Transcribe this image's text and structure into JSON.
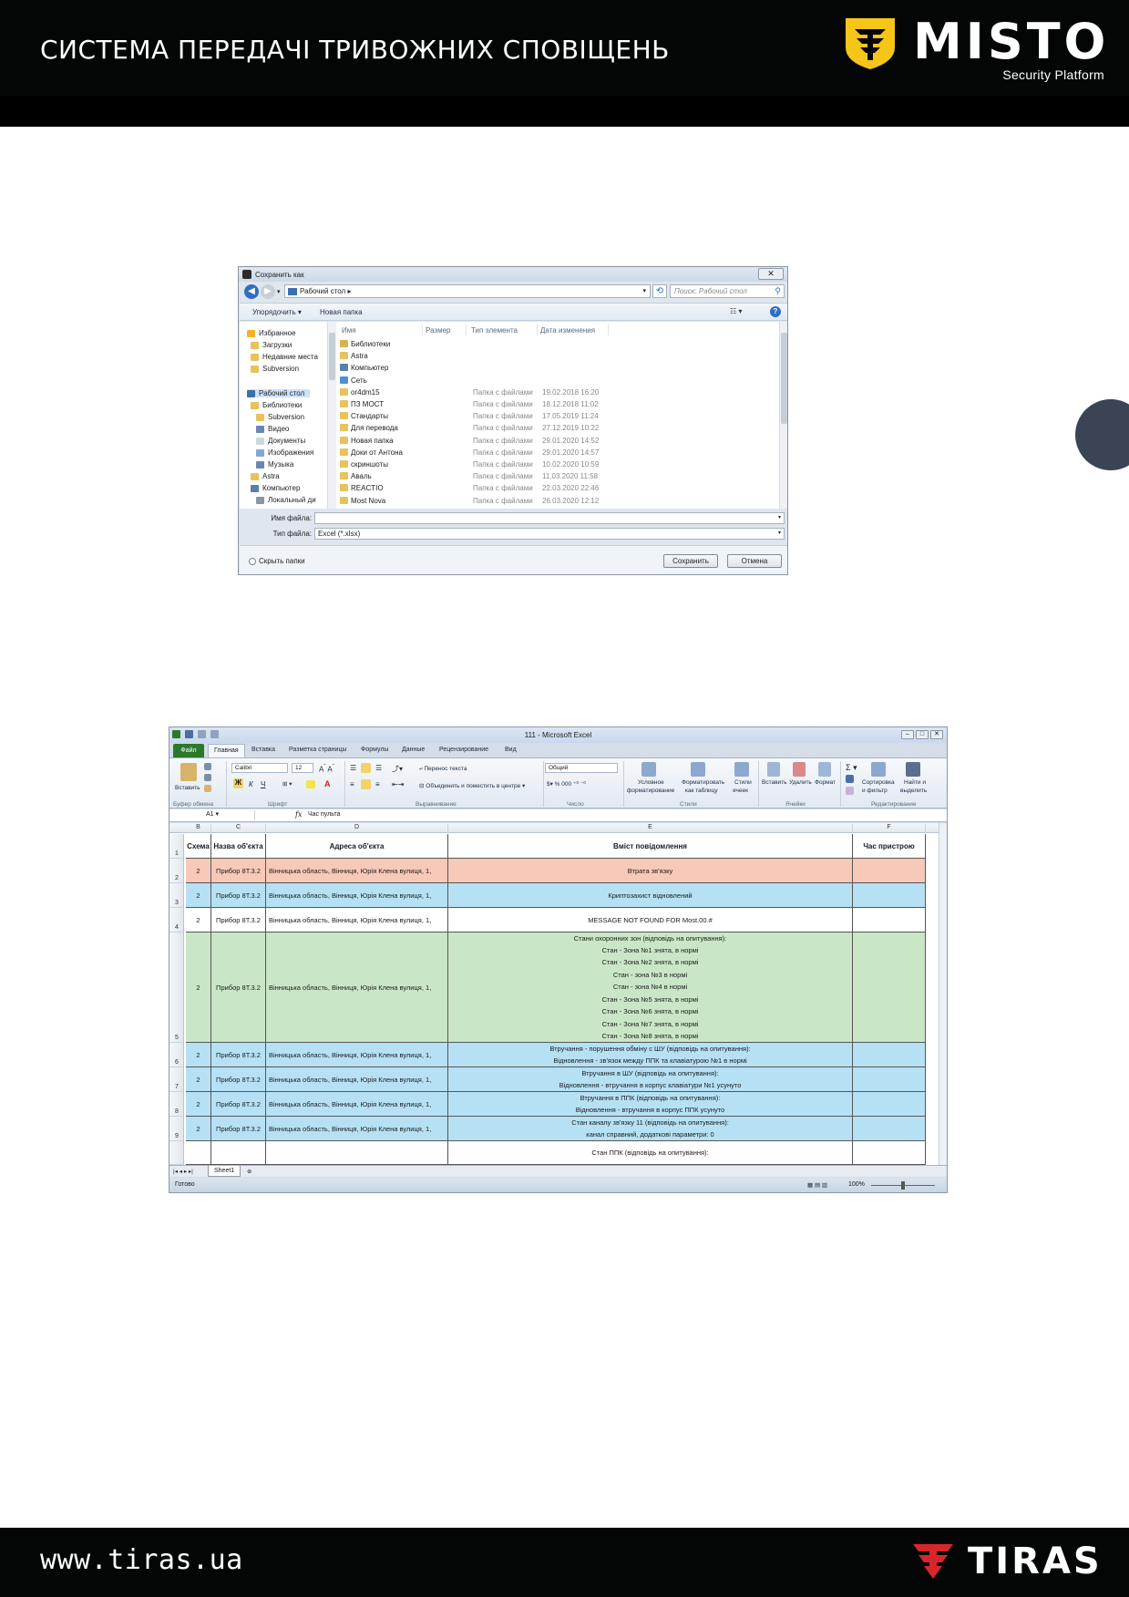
{
  "header": {
    "title": "СИСТЕМА ПЕРЕДАЧІ ТРИВОЖНИХ СПОВІЩЕНЬ",
    "logo_word": "MISTO",
    "logo_sub": "Security Platform"
  },
  "footer": {
    "url": "www.tiras.ua",
    "logo_word": "TIRAS"
  },
  "colors": {
    "header_bg": "#040606",
    "accent_yellow": "#f5c518",
    "footer_accent_red": "#d7262b",
    "side_dot": "#3a4455"
  },
  "save_dialog": {
    "title": "Сохранить как",
    "close_label": "✕",
    "address": "Рабочий стол",
    "search_placeholder": "Поиск: Рабочий стол",
    "toolbar": {
      "organize": "Упорядочить ▾",
      "new_folder": "Новая папка"
    },
    "tree": [
      {
        "label": "Избранное",
        "icon": "star-icon"
      },
      {
        "label": "Загрузки",
        "icon": "folder-icon"
      },
      {
        "label": "Недавние места",
        "icon": "folder-icon"
      },
      {
        "label": "Subversion",
        "icon": "folder-icon"
      },
      {
        "label": "Рабочий стол",
        "icon": "desktop-icon"
      },
      {
        "label": "Библиотеки",
        "icon": "folder-icon"
      },
      {
        "label": "Subversion",
        "icon": "folder-icon"
      },
      {
        "label": "Видео",
        "icon": "video-icon"
      },
      {
        "label": "Документы",
        "icon": "document-icon"
      },
      {
        "label": "Изображения",
        "icon": "image-icon"
      },
      {
        "label": "Музыка",
        "icon": "music-icon"
      },
      {
        "label": "Astra",
        "icon": "folder-icon"
      },
      {
        "label": "Компьютер",
        "icon": "computer-icon"
      },
      {
        "label": "Локальный ди",
        "icon": "disk-icon"
      }
    ],
    "columns": {
      "name": "Имя",
      "size": "Размер",
      "type": "Тип элемента",
      "date": "Дата изменения"
    },
    "files": [
      {
        "name": "Библиотеки",
        "type": "",
        "date": "",
        "icon": "library-icon"
      },
      {
        "name": "Astra",
        "type": "",
        "date": "",
        "icon": "folder-icon"
      },
      {
        "name": "Компьютер",
        "type": "",
        "date": "",
        "icon": "computer-icon"
      },
      {
        "name": "Сеть",
        "type": "",
        "date": "",
        "icon": "network-icon"
      },
      {
        "name": "or4dm15",
        "type": "Папка с файлами",
        "date": "19.02.2018 16:20",
        "icon": "folder-icon"
      },
      {
        "name": "ПЗ МОСТ",
        "type": "Папка с файлами",
        "date": "18.12.2018 11:02",
        "icon": "folder-icon"
      },
      {
        "name": "Стандарты",
        "type": "Папка с файлами",
        "date": "17.05.2019 11:24",
        "icon": "folder-icon"
      },
      {
        "name": "Для перевода",
        "type": "Папка с файлами",
        "date": "27.12.2019 10:22",
        "icon": "folder-icon"
      },
      {
        "name": "Новая папка",
        "type": "Папка с файлами",
        "date": "29.01.2020 14:52",
        "icon": "folder-icon"
      },
      {
        "name": "Доки от Антона",
        "type": "Папка с файлами",
        "date": "29.01.2020 14:57",
        "icon": "folder-icon"
      },
      {
        "name": "скриншоты",
        "type": "Папка с файлами",
        "date": "10.02.2020 10:59",
        "icon": "folder-icon"
      },
      {
        "name": "Аваль",
        "type": "Папка с файлами",
        "date": "11.03.2020 11:58",
        "icon": "folder-icon"
      },
      {
        "name": "REACTIO",
        "type": "Папка с файлами",
        "date": "22.03.2020 22:46",
        "icon": "folder-icon"
      },
      {
        "name": "Most Nova",
        "type": "Папка с файлами",
        "date": "26.03.2020 12:12",
        "icon": "folder-icon"
      }
    ],
    "filename_label": "Имя файла:",
    "filename_value": "",
    "filetype_label": "Тип файла:",
    "filetype_value": "Excel (*.xlsx)",
    "hide_folders": "Скрыть папки",
    "save_button": "Сохранить",
    "cancel_button": "Отмена"
  },
  "excel": {
    "title": "111 - Microsoft Excel",
    "tabs": {
      "file": "Файл",
      "home": "Главная",
      "insert": "Вставка",
      "layout": "Разметка страницы",
      "formulas": "Формулы",
      "data": "Данные",
      "review": "Рецензирование",
      "view": "Вид"
    },
    "ribbon": {
      "paste": "Вставить",
      "font_name": "Calibri",
      "font_size": "12",
      "wrap_text": "Перенос текста",
      "merge_center": "Объединить и поместить в центре",
      "number_format": "Общий",
      "conditional": "Условное",
      "conditional2": "форматирование",
      "format_table": "Форматировать",
      "format_table2": "как таблицу",
      "cell_styles": "Стили",
      "cell_styles2": "ячеек",
      "insert": "Вставить",
      "delete": "Удалить",
      "format": "Формат",
      "sort": "Сортировка",
      "sort2": "и фильтр",
      "find": "Найти и",
      "find2": "выделить",
      "groups": {
        "clipboard": "Буфер обмена",
        "font": "Шрифт",
        "alignment": "Выравнивание",
        "number": "Число",
        "styles": "Стили",
        "cells": "Ячейки",
        "editing": "Редактирование"
      }
    },
    "name_box": "A1",
    "formula_value": "Час пульта",
    "col_letters": [
      "B",
      "C",
      "D",
      "E",
      "F"
    ],
    "headers": [
      "Схема",
      "Назва об'єкта",
      "Адреса об'єкта",
      "Вміст повідомлення",
      "Час пристрою"
    ],
    "rows": [
      {
        "num": "2",
        "scheme": "2",
        "name": "Прибор 8Т.3.2",
        "addr": "Вінницька область, Вінниця, Юрія Клена вулиця, 1,",
        "msg": [
          "Втрата зв'язку"
        ],
        "color": "#f8c9b8"
      },
      {
        "num": "3",
        "scheme": "2",
        "name": "Прибор 8Т.3.2",
        "addr": "Вінницька область, Вінниця, Юрія Клена вулиця, 1,",
        "msg": [
          "Криптозахист відновлений"
        ],
        "color": "#b6e1f5"
      },
      {
        "num": "4",
        "scheme": "2",
        "name": "Прибор 8Т.3.2",
        "addr": "Вінницька область, Вінниця, Юрія Клена вулиця, 1,",
        "msg": [
          "MESSAGE NOT FOUND FOR Most.00.#"
        ],
        "color": "#ffffff"
      },
      {
        "num": "5",
        "scheme": "2",
        "name": "Прибор 8Т.3.2",
        "addr": "Вінницька область, Вінниця, Юрія Клена вулиця, 1,",
        "msg": [
          "Стани охоронних зон (відповідь на опитування):",
          "Стан - Зона №1 знята, в нормі",
          "Стан - Зона №2 знята, в нормі",
          "Стан - зона №3 в нормі",
          "Стан - зона №4 в нормі",
          "Стан - Зона №5 знята, в нормі",
          "Стан - Зона №6 знята, в нормі",
          "Стан - Зона №7 знята, в нормі",
          "Стан - Зона №8 знята, в нормі"
        ],
        "color": "#c9e7c6"
      },
      {
        "num": "6",
        "scheme": "2",
        "name": "Прибор 8Т.3.2",
        "addr": "Вінницька область, Вінниця, Юрія Клена вулиця, 1,",
        "msg": [
          "Втручання - порушення обміну с ШУ (відповідь на опитування):",
          "Відновлення - зв'язок между ППК та клавіатурою №1 в нормі"
        ],
        "color": "#b6e1f5"
      },
      {
        "num": "7",
        "scheme": "2",
        "name": "Прибор 8Т.3.2",
        "addr": "Вінницька область, Вінниця, Юрія Клена вулиця, 1,",
        "msg": [
          "Втручання в ШУ (відповідь на опитування):",
          "Відновлення - втручання в корпус клавіатури №1 усунуто"
        ],
        "color": "#b6e1f5"
      },
      {
        "num": "8",
        "scheme": "2",
        "name": "Прибор 8Т.3.2",
        "addr": "Вінницька область, Вінниця, Юрія Клена вулиця, 1,",
        "msg": [
          "Втручання в ППК (відповідь на опитування):",
          "Відновлення - втручання в корпус ППК усунуто"
        ],
        "color": "#b6e1f5"
      },
      {
        "num": "9",
        "scheme": "2",
        "name": "Прибор 8Т.3.2",
        "addr": "Вінницька область, Вінниця, Юрія Клена вулиця, 1,",
        "msg": [
          "Стан каналу зв'язку 11 (відповідь на опитування):",
          "канал справний, додаткові параметри: 0"
        ],
        "color": "#b6e1f5"
      },
      {
        "num": "",
        "scheme": "",
        "name": "",
        "addr": "",
        "msg": [
          "Стан ППК (відповідь на опитування):"
        ],
        "color": "#ffffff"
      }
    ],
    "sheet_tab": "Sheet1",
    "status_ready": "Готово",
    "zoom": "100%"
  }
}
